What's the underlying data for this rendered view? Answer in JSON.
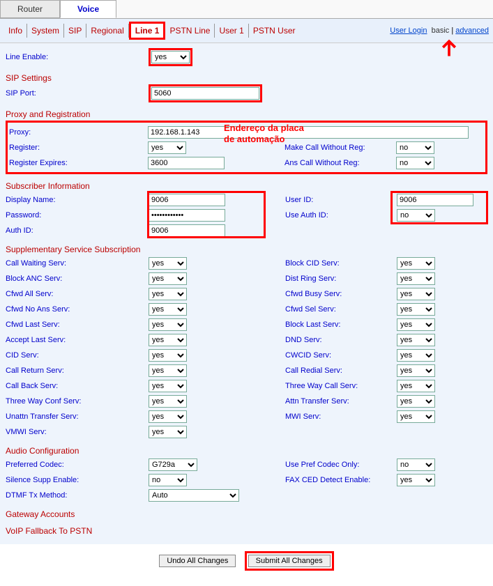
{
  "tabs": {
    "router": "Router",
    "voice": "Voice"
  },
  "subtabs": {
    "info": "Info",
    "system": "System",
    "sip": "SIP",
    "regional": "Regional",
    "line1": "Line 1",
    "pstn_line": "PSTN Line",
    "user1": "User 1",
    "pstn_user": "PSTN User"
  },
  "toplinks": {
    "user_login": "User Login",
    "basic": "basic",
    "advanced": "advanced"
  },
  "line_enable": {
    "label": "Line Enable:",
    "value": "yes"
  },
  "sip_settings": {
    "title": "SIP Settings",
    "port_label": "SIP Port:",
    "port": "5060"
  },
  "proxy_reg": {
    "title": "Proxy and Registration",
    "proxy_label": "Proxy:",
    "proxy": "192.168.1.143",
    "register_label": "Register:",
    "register": "yes",
    "make_call_label": "Make Call Without Reg:",
    "make_call": "no",
    "reg_exp_label": "Register Expires:",
    "reg_exp": "3600",
    "ans_call_label": "Ans Call Without Reg:",
    "ans_call": "no"
  },
  "annot": {
    "proxy_note1": "Endereço da placa",
    "proxy_note2": "de automação"
  },
  "subscriber": {
    "title": "Subscriber Information",
    "display_label": "Display Name:",
    "display": "9006",
    "userid_label": "User ID:",
    "userid": "9006",
    "pwd_label": "Password:",
    "pwd": "************",
    "useauth_label": "Use Auth ID:",
    "useauth": "no",
    "authid_label": "Auth ID:",
    "authid": "9006"
  },
  "supp": {
    "title": "Supplementary Service Subscription",
    "cw": "Call Waiting Serv:",
    "cw_v": "yes",
    "blockcid": "Block CID Serv:",
    "blockcid_v": "yes",
    "blockanc": "Block ANC Serv:",
    "blockanc_v": "yes",
    "distring": "Dist Ring Serv:",
    "distring_v": "yes",
    "cfwdall": "Cfwd All Serv:",
    "cfwdall_v": "yes",
    "cfwdbusy": "Cfwd Busy Serv:",
    "cfwdbusy_v": "yes",
    "cfwdna": "Cfwd No Ans Serv:",
    "cfwdna_v": "yes",
    "cfwdsel": "Cfwd Sel Serv:",
    "cfwdsel_v": "yes",
    "cfwdlast": "Cfwd Last Serv:",
    "cfwdlast_v": "yes",
    "blocklast": "Block Last Serv:",
    "blocklast_v": "yes",
    "acceptlast": "Accept Last Serv:",
    "acceptlast_v": "yes",
    "dnd": "DND Serv:",
    "dnd_v": "yes",
    "cid": "CID Serv:",
    "cid_v": "yes",
    "cwcid": "CWCID Serv:",
    "cwcid_v": "yes",
    "callret": "Call Return Serv:",
    "callret_v": "yes",
    "callredial": "Call Redial Serv:",
    "callredial_v": "yes",
    "callback": "Call Back Serv:",
    "callback_v": "yes",
    "threeway": "Three Way Call Serv:",
    "threeway_v": "yes",
    "threeconf": "Three Way Conf Serv:",
    "threeconf_v": "yes",
    "attntr": "Attn Transfer Serv:",
    "attntr_v": "yes",
    "unattntr": "Unattn Transfer Serv:",
    "unattntr_v": "yes",
    "mwi": "MWI Serv:",
    "mwi_v": "yes",
    "vmwi": "VMWI Serv:",
    "vmwi_v": "yes"
  },
  "audio": {
    "title": "Audio Configuration",
    "pref_label": "Preferred Codec:",
    "pref": "G729a",
    "useonly_label": "Use Pref Codec Only:",
    "useonly": "no",
    "silence_label": "Silence Supp Enable:",
    "silence": "no",
    "faxced_label": "FAX CED Detect Enable:",
    "faxced": "yes",
    "dtmf_label": "DTMF Tx Method:",
    "dtmf": "Auto"
  },
  "gateway": {
    "title": "Gateway Accounts"
  },
  "voip_fallback": {
    "title": "VoIP Fallback To PSTN"
  },
  "buttons": {
    "undo": "Undo All Changes",
    "submit": "Submit All Changes"
  }
}
